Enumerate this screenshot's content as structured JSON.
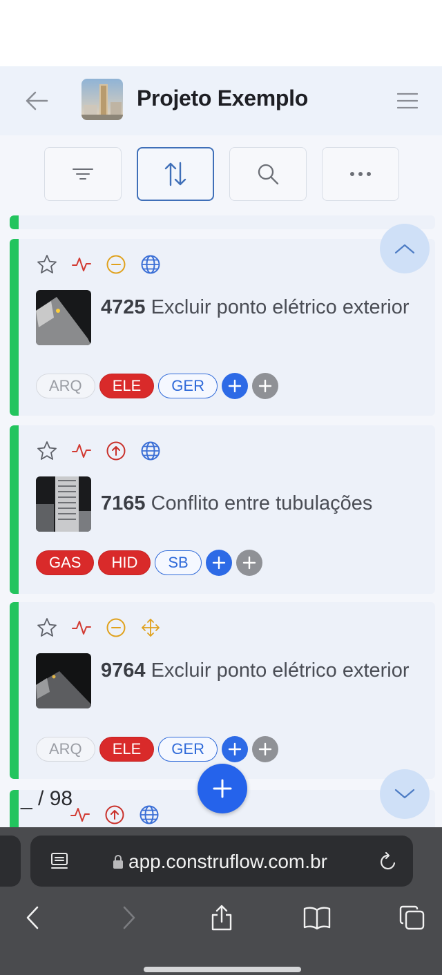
{
  "header": {
    "title": "Projeto Exemplo",
    "back_icon": "arrow-left-icon",
    "menu_icon": "hamburger-menu-icon"
  },
  "toolbar": {
    "buttons": [
      {
        "icon": "filter-lines-icon"
      },
      {
        "icon": "sort-arrows-icon",
        "active": true
      },
      {
        "icon": "search-icon"
      },
      {
        "icon": "more-dots-icon"
      }
    ]
  },
  "issues": [
    {
      "number": "4725",
      "title": "Excluir ponto elétrico exterior",
      "status_icons": [
        "star-icon",
        "activity-icon",
        "minus-circle-icon",
        "globe-icon"
      ],
      "tags": [
        {
          "label": "ARQ",
          "style": "gray"
        },
        {
          "label": "ELE",
          "style": "red"
        },
        {
          "label": "GER",
          "style": "blue"
        }
      ]
    },
    {
      "number": "7165",
      "title": "Conflito entre tubulações",
      "status_icons": [
        "star-icon",
        "activity-icon",
        "arrow-up-circle-icon",
        "globe-icon"
      ],
      "tags": [
        {
          "label": "GAS",
          "style": "red"
        },
        {
          "label": "HID",
          "style": "red"
        },
        {
          "label": "SB",
          "style": "blue"
        }
      ]
    },
    {
      "number": "9764",
      "title": "Excluir ponto elétrico exterior",
      "status_icons": [
        "star-icon",
        "activity-icon",
        "minus-circle-icon",
        "move-arrows-icon"
      ],
      "tags": [
        {
          "label": "ARQ",
          "style": "gray"
        },
        {
          "label": "ELE",
          "style": "red"
        },
        {
          "label": "GER",
          "style": "blue"
        }
      ]
    }
  ],
  "pagination": {
    "text": "_ / 98"
  },
  "browser": {
    "url": "app.construflow.com.br"
  },
  "colors": {
    "accent_blue": "#2563eb",
    "status_green": "#23c45e",
    "tag_red": "#d92a2a"
  }
}
